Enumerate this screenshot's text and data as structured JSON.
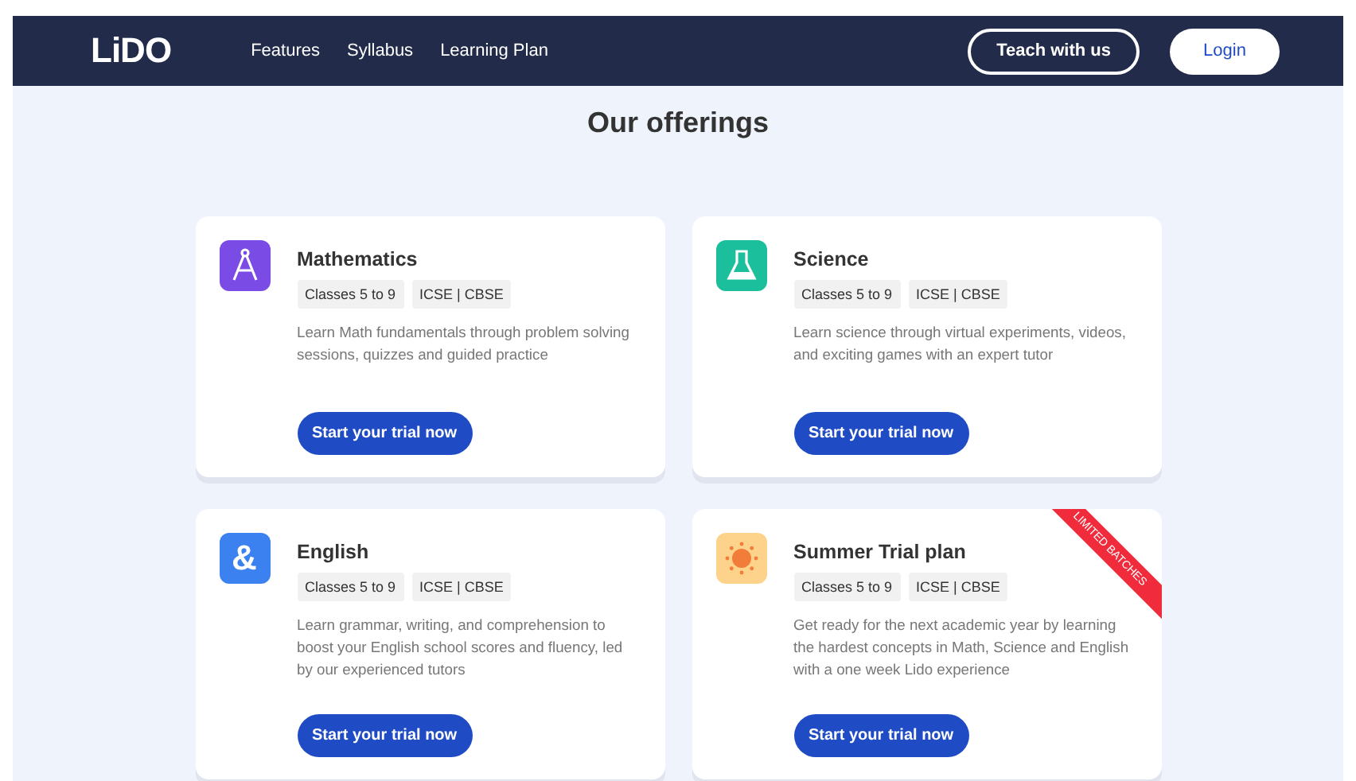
{
  "nav": {
    "logo": "LiDO",
    "links": [
      "Features",
      "Syllabus",
      "Learning Plan"
    ],
    "buttons": [
      {
        "label": "Teach with us",
        "kind": "outline"
      },
      {
        "label": "Login",
        "kind": "solid"
      }
    ]
  },
  "heading": "Our offerings",
  "cards": [
    {
      "kind": "compass",
      "title": "Mathematics",
      "tags": [
        "Classes 5 to 9",
        "ICSE | CBSE"
      ],
      "description": "Learn Math fundamentals through problem solving sessions, quizzes and guided practice",
      "button": "Start your trial now"
    },
    {
      "kind": "flask",
      "title": "Science",
      "tags": [
        "Classes 5 to 9",
        "ICSE | CBSE"
      ],
      "description": "Learn science through virtual experiments, videos, and exciting games with an expert tutor",
      "button": "Start your trial now"
    },
    {
      "kind": "ampersand",
      "icon_glyph": "&",
      "title": "English",
      "tags": [
        "Classes 5 to 9",
        "ICSE | CBSE"
      ],
      "description": "Learn grammar, writing, and comprehension to boost your English school scores and fluency, led by our experienced tutors",
      "button": "Start your trial now"
    },
    {
      "kind": "sun",
      "title": "Summer Trial plan",
      "tags": [
        "Classes 5 to 9",
        "ICSE | CBSE"
      ],
      "description": "Get ready for the next academic year by learning the hardest concepts in Math, Science and English with a one week Lido experience",
      "button": "Start your trial now",
      "ribbon": "LIMITED BATCHES"
    }
  ]
}
